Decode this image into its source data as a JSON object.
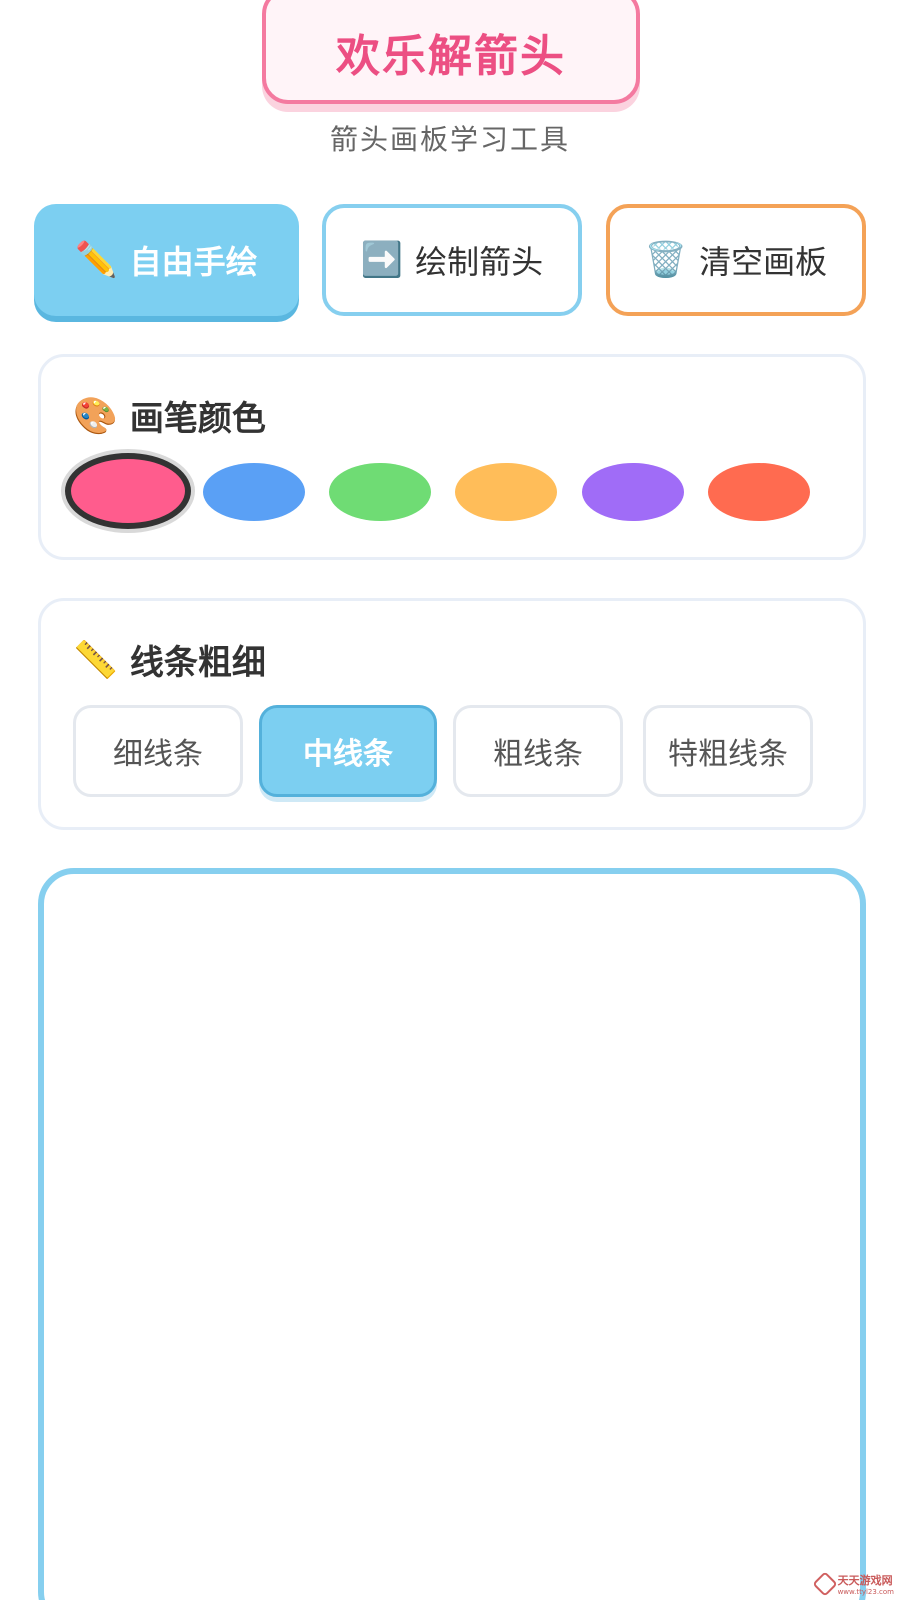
{
  "header": {
    "title": "欢乐解箭头",
    "subtitle": "箭头画板学习工具"
  },
  "modes": {
    "free": {
      "icon": "pencil-icon",
      "glyph": "✏️",
      "label": "自由手绘"
    },
    "arrow": {
      "icon": "right-arrow-icon",
      "glyph": "➡️",
      "label": "绘制箭头"
    },
    "clear": {
      "icon": "trash-icon",
      "glyph": "🗑️",
      "label": "清空画板"
    }
  },
  "color_panel": {
    "icon": "palette-icon",
    "glyph": "🎨",
    "title": "画笔颜色",
    "selected_index": 0,
    "colors": [
      "#ff5c8d",
      "#5aa0f5",
      "#6fdc74",
      "#ffbd59",
      "#a06cf7",
      "#ff6b50"
    ]
  },
  "width_panel": {
    "icon": "ruler-icon",
    "glyph": "📏",
    "title": "线条粗细",
    "selected_index": 1,
    "options": [
      "细线条",
      "中线条",
      "粗线条",
      "特粗线条"
    ]
  },
  "watermark": {
    "text": "天天游戏网",
    "subtext": "www.ttyl23.com"
  }
}
